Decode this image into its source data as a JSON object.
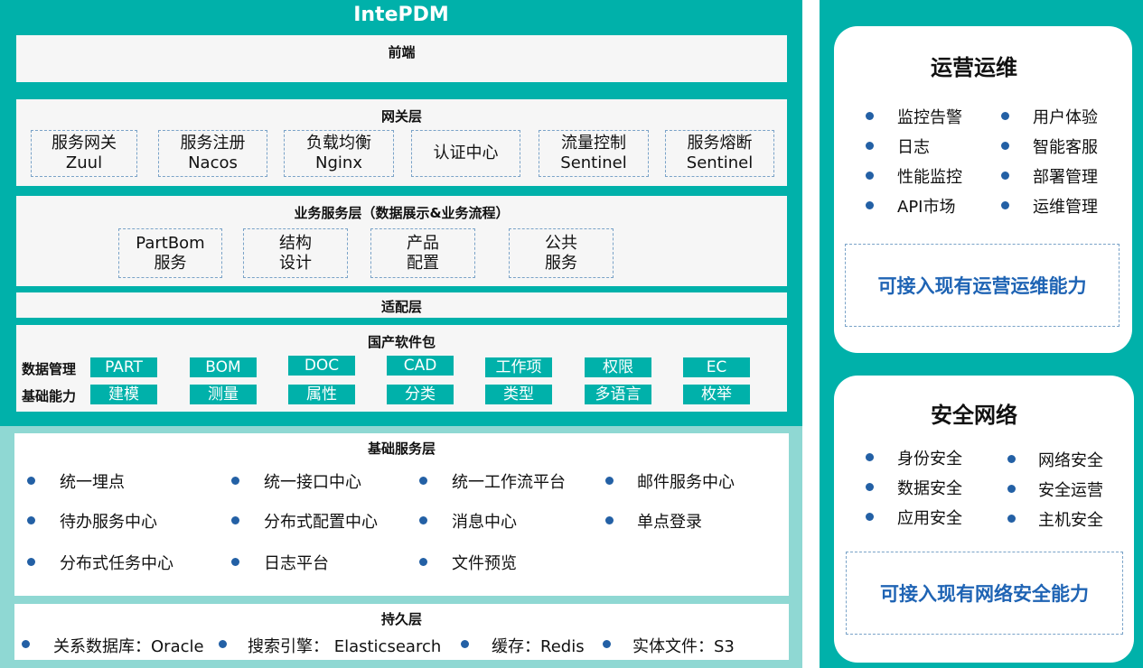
{
  "app_title": "IntePDM",
  "frontend": {
    "title": "前端"
  },
  "gateway": {
    "title": "网关层",
    "items": [
      {
        "line1": "服务网关",
        "line2": "Zuul"
      },
      {
        "line1": "服务注册",
        "line2": "Nacos"
      },
      {
        "line1": "负载均衡",
        "line2": "Nginx"
      },
      {
        "line1": "认证中心",
        "line2": ""
      },
      {
        "line1": "流量控制",
        "line2": "Sentinel"
      },
      {
        "line1": "服务熔断",
        "line2": "Sentinel"
      }
    ]
  },
  "business": {
    "title": "业务服务层（数据展示&业务流程）",
    "items": [
      {
        "line1": "PartBom",
        "line2": "服务"
      },
      {
        "line1": "结构",
        "line2": "设计"
      },
      {
        "line1": "产品",
        "line2": "配置"
      },
      {
        "line1": "公共",
        "line2": "服务"
      }
    ]
  },
  "adapter": {
    "title": "适配层"
  },
  "domestic": {
    "title": "国产软件包",
    "row1_label": "数据管理",
    "row1": [
      "PART",
      "BOM",
      "DOC",
      "CAD",
      "工作项",
      "权限",
      "EC"
    ],
    "row2_label": "基础能力",
    "row2": [
      "建模",
      "测量",
      "属性",
      "分类",
      "类型",
      "多语言",
      "枚举"
    ]
  },
  "base_services": {
    "title": "基础服务层",
    "items": [
      "统一埋点",
      "统一接口中心",
      "统一工作流平台",
      "邮件服务中心",
      "待办服务中心",
      "分布式配置中心",
      "消息中心",
      "单点登录",
      "分布式任务中心",
      "日志平台",
      "文件预览"
    ]
  },
  "persistence": {
    "title": "持久层",
    "items": [
      "关系数据库：Oracle",
      "搜索引擎：  Elasticsearch",
      "缓存：Redis",
      "实体文件：S3"
    ]
  },
  "ops": {
    "title": "运营运维",
    "items": [
      "监控告警",
      "用户体验",
      "日志",
      "智能客服",
      "性能监控",
      "部署管理",
      "API市场",
      "运维管理"
    ],
    "capability": "可接入现有运营运维能力"
  },
  "security": {
    "title": "安全网络",
    "items": [
      "身份安全",
      "网络安全",
      "数据安全",
      "安全运营",
      "应用安全",
      "主机安全"
    ],
    "capability": "可接入现有网络安全能力"
  },
  "colors": {
    "teal": "#00b1aa",
    "light_teal": "#8fd8d3",
    "bullet_blue": "#2360a5",
    "capability_blue": "#1f64b4"
  }
}
